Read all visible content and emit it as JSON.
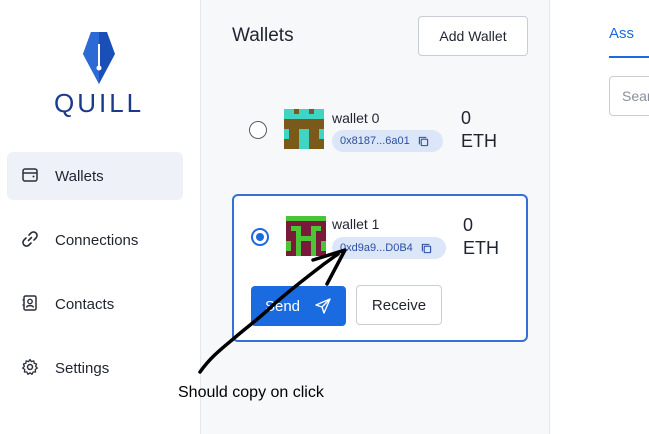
{
  "sidebar": {
    "logo_text": "QUILL",
    "items": [
      {
        "label": "Wallets",
        "icon": "wallet-icon",
        "active": true
      },
      {
        "label": "Connections",
        "icon": "link-icon",
        "active": false
      },
      {
        "label": "Contacts",
        "icon": "contacts-icon",
        "active": false
      },
      {
        "label": "Settings",
        "icon": "gear-icon",
        "active": false
      }
    ]
  },
  "main": {
    "title": "Wallets",
    "add_button": "Add Wallet",
    "wallets": [
      {
        "name": "wallet 0",
        "address": "0x8187...6a01",
        "balance": "0",
        "unit": "ETH",
        "selected": false
      },
      {
        "name": "wallet 1",
        "address": "0xd9a9...D0B4",
        "balance": "0",
        "unit": "ETH",
        "selected": true
      }
    ],
    "send_button": "Send",
    "receive_button": "Receive"
  },
  "right_panel": {
    "tab_label": "Ass",
    "search_placeholder": "Sear"
  },
  "annotation": {
    "text": "Should copy on click"
  },
  "colors": {
    "accent": "#1a6ae0",
    "logo": "#1b3a8c",
    "address_pill": "#dbe6f8"
  }
}
